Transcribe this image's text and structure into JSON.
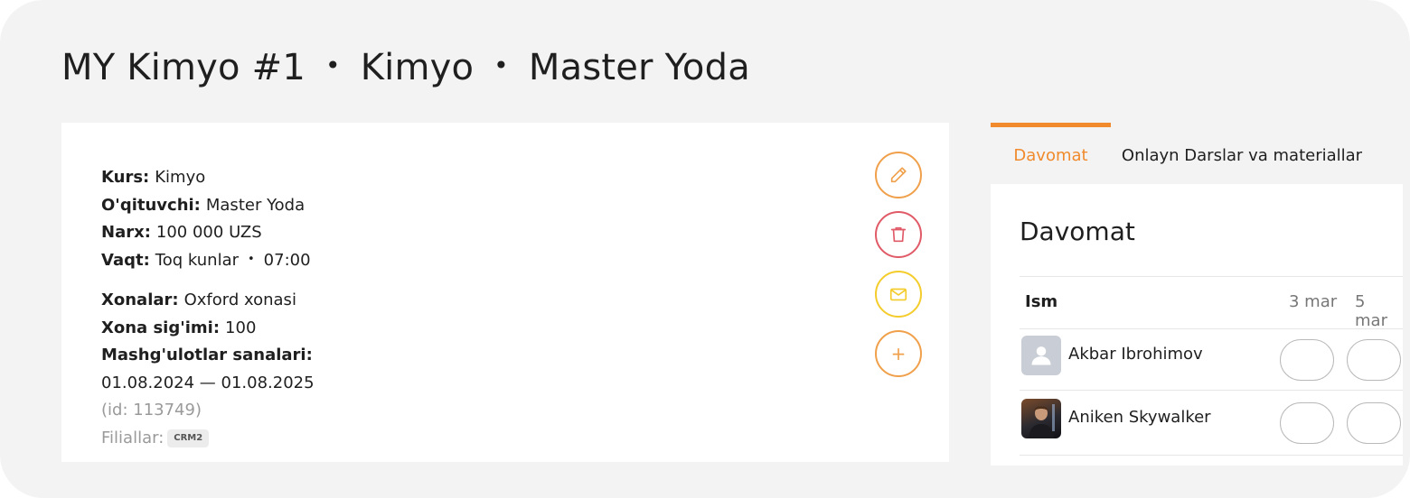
{
  "page_title": {
    "group": "MY Kimyo #1",
    "sep1": "•",
    "course": "Kimyo",
    "sep2": "•",
    "teacher": "Master Yoda"
  },
  "info": {
    "kurs_label": "Kurs:",
    "kurs_value": "Kimyo",
    "teacher_label": "O'qituvchi:",
    "teacher_value": "Master Yoda",
    "price_label": "Narx:",
    "price_value": "100 000 UZS",
    "time_label": "Vaqt:",
    "time_days": "Toq kunlar",
    "time_sep": "•",
    "time_hour": "07:00",
    "rooms_label": "Xonalar:",
    "rooms_value": "Oxford xonasi",
    "capacity_label": "Xona sig'imi:",
    "capacity_value": "100",
    "dates_label": "Mashg'ulotlar sanalari:",
    "dates_value": "01.08.2024 — 01.08.2025",
    "id_text": "(id: 113749)",
    "branches_label": "Filiallar:",
    "branch_badge": "CRM2"
  },
  "actions": [
    {
      "name": "edit",
      "icon": "pencil-icon",
      "color": "#f0a04b"
    },
    {
      "name": "delete",
      "icon": "trash-icon",
      "color": "#e05a67"
    },
    {
      "name": "message",
      "icon": "envelope-icon",
      "color": "#f4cc2c"
    },
    {
      "name": "add",
      "icon": "plus-icon",
      "color": "#f0a04b",
      "glyph": "+"
    }
  ],
  "tabs": [
    {
      "label": "Davomat",
      "active": true
    },
    {
      "label": "Onlayn Darslar va materiallar",
      "active": false
    }
  ],
  "attendance": {
    "title": "Davomat",
    "name_header": "Ism",
    "dates": [
      "3 mar",
      "5 mar"
    ],
    "students": [
      {
        "name": "Akbar Ibrohimov",
        "avatar": "placeholder-avatar-icon"
      },
      {
        "name": "Aniken Skywalker",
        "avatar": "photo-avatar"
      }
    ]
  },
  "colors": {
    "accent": "#f08a2c",
    "background": "#f3f3f3"
  }
}
